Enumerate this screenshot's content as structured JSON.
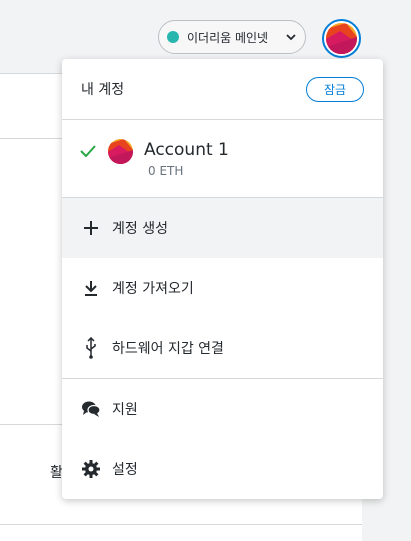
{
  "network": {
    "label": "이더리움 메인넷",
    "dot_color": "#29b6af"
  },
  "background": {
    "peek_text": "활"
  },
  "menu": {
    "title": "내 계정",
    "lock_label": "잠금",
    "account": {
      "name": "Account 1",
      "balance": "0 ETH",
      "selected": true
    },
    "items": [
      {
        "label": "계정 생성",
        "icon": "plus-icon"
      },
      {
        "label": "계정 가져오기",
        "icon": "download-icon"
      },
      {
        "label": "하드웨어 지갑 연결",
        "icon": "usb-icon"
      },
      {
        "label": "지원",
        "icon": "chat-bubbles-icon"
      },
      {
        "label": "설정",
        "icon": "gear-icon"
      }
    ]
  },
  "colors": {
    "accent": "#037dd6",
    "check": "#28a745"
  }
}
